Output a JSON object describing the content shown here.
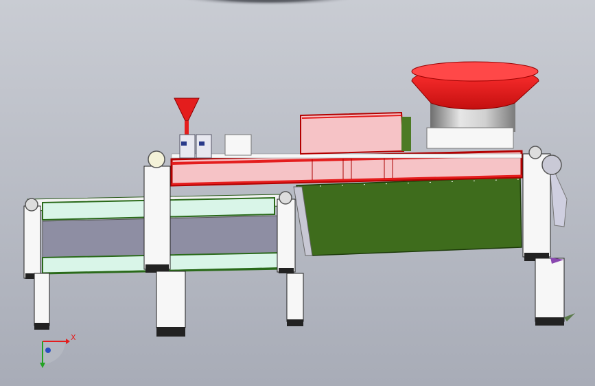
{
  "viewport": {
    "background_top": "#c7cad1",
    "background_bottom": "#a9adb8",
    "vignette": "#2a2d33"
  },
  "colors": {
    "red": "#e41d1d",
    "pink": "#f6c3c6",
    "green": "#3c6a1a",
    "mint": "#d9f5e8",
    "slate": "#8e8ea3",
    "white": "#f7f7f7",
    "steel": "#bcbcbc",
    "purple": "#8a48b0"
  },
  "triad": {
    "x_label": "X",
    "x_color": "#e41d1d",
    "y_color": "#23a323",
    "z_color": "#2a4fbf"
  },
  "model_parts": [
    "hopper-cone",
    "small-funnel",
    "main-frame",
    "upper-housing",
    "inclined-green-conveyor",
    "flat-belt-conveyor",
    "support-legs",
    "end-pulleys"
  ]
}
